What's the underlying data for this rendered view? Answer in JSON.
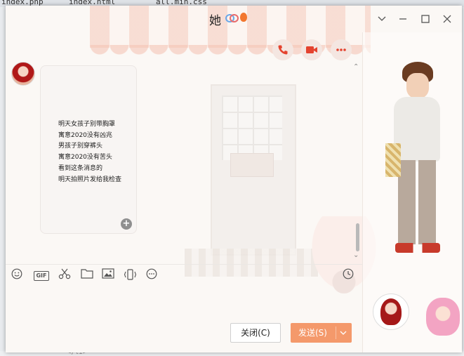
{
  "background": {
    "tabs": [
      "index.php",
      "index.html",
      "all.min.css"
    ],
    "bottom_text": "</li>"
  },
  "window": {
    "title": "她",
    "title_icons": [
      "linked-rings-icon",
      "fire-icon"
    ],
    "controls": [
      "chevron-down-icon",
      "minimize-icon",
      "maximize-icon",
      "close-icon"
    ]
  },
  "header_actions": [
    "phone-icon",
    "video-icon",
    "more-icon"
  ],
  "message": {
    "lines": [
      "明天女孩子别带胸罩",
      "寓意2020没有凶兆",
      "男孩子别穿裤头",
      "寓意2020没有苦头",
      "看到这条消息的",
      "明天拍照片发给我检查"
    ]
  },
  "toolbar": {
    "gif_label": "GIF",
    "icons": [
      "emoji-icon",
      "gif-icon",
      "scissors-icon",
      "folder-icon",
      "image-icon",
      "shake-icon",
      "more-options-icon",
      "history-clock-icon"
    ]
  },
  "buttons": {
    "close_label": "关闭(C)",
    "send_label": "发送(S)"
  },
  "colors": {
    "accent": "#f4996b",
    "action_icon": "#e4432f"
  }
}
